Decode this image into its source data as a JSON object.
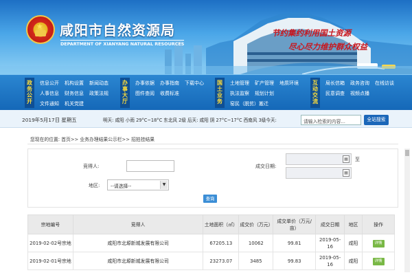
{
  "header": {
    "site_title": "咸阳市自然资源局",
    "site_subtitle": "DEPARTMENT OF XIANYANG NATURAL RESOURCES",
    "slogan_line1": "节约集约利用国土资源",
    "slogan_line2": "尽心尽力维护群众权益"
  },
  "nav": {
    "groups": [
      {
        "head": "政务公开",
        "links": [
          "信息公开",
          "机构设置",
          "新闻动态",
          "人事信息",
          "财务信息",
          "政策法规",
          "文件通知",
          "机关党建"
        ]
      },
      {
        "head": "办事大厅",
        "links": [
          "办事依据",
          "办事指南",
          "下载中心",
          "图件查阅",
          "收费标准"
        ]
      },
      {
        "head": "国土业务",
        "links": [
          "土地管理",
          "矿产管理",
          "地质环境",
          "执法监察",
          "规划计划",
          "窑民（脱贫）搬迁"
        ]
      },
      {
        "head": "互动交流",
        "links": [
          "局长信箱",
          "政务咨询",
          "在线访谈",
          "民意调查",
          "视频点播"
        ]
      }
    ]
  },
  "datebar": {
    "date": "2019年5月17日  星期五",
    "weather_text": "明天: 咸阳 小雨 29°C~18°C 东北风 2级 后天: 咸阳 阴 27°C~17°C 西南风 3级今天:",
    "search_placeholder": "请输入检索的内容...",
    "search_button": "全站搜索"
  },
  "breadcrumb": "您现在的位置: 首页>> 业务办理结果公示栏>> 招拍挂结果",
  "form": {
    "bidder_label": "竞得人:",
    "date_label": "成交日期:",
    "date_to": "至",
    "region_label": "地区:",
    "region_value": "--请选择--",
    "query_button": "查询"
  },
  "table": {
    "headers": [
      "宗地编号",
      "竞得人",
      "土地面积（㎡）",
      "成交价（万元）",
      "成交单价（万元/亩）",
      "成交日期",
      "地区",
      "操作"
    ],
    "rows": [
      {
        "parcel": "2019-02-02号宗地",
        "bidder": "咸阳市北塬新城发展有限公司",
        "area": "67205.13",
        "price": "10062",
        "unit_price": "99.81",
        "date": "2019-05-16",
        "region": "咸阳",
        "op": "详情"
      },
      {
        "parcel": "2019-02-01号宗地",
        "bidder": "咸阳市北塬新城发展有限公司",
        "area": "23273.07",
        "price": "3485",
        "unit_price": "99.83",
        "date": "2019-05-16",
        "region": "咸阳",
        "op": "详情"
      }
    ]
  },
  "colors": {
    "header_blue": "#1d6fc4",
    "nav_blue": "#1568b8",
    "accent_red": "#c8161d",
    "detail_green": "#79b845"
  }
}
